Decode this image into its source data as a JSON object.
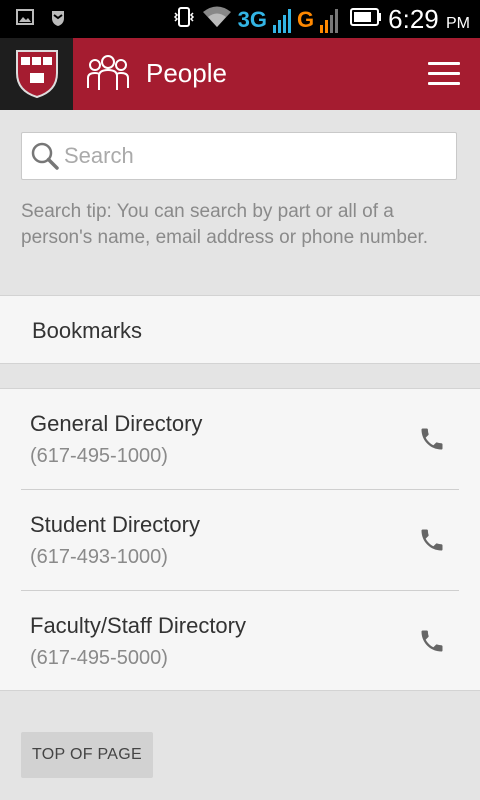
{
  "status_bar": {
    "network_3g": "3G",
    "network_g": "G",
    "time": "6:29",
    "ampm": "PM",
    "icons": [
      "image-icon",
      "shield-icon",
      "vibrate-icon",
      "wifi-icon",
      "signal-icon",
      "battery-icon"
    ]
  },
  "app_bar": {
    "title": "People",
    "logo": "harvard-shield-logo",
    "section_icon": "people-icon",
    "menu_icon": "hamburger-menu-icon",
    "background_color": "#a51c30"
  },
  "search": {
    "placeholder": "Search",
    "value": "",
    "tip": "Search tip: You can search by part or all of a person's name, email address or phone number."
  },
  "bookmarks": {
    "label": "Bookmarks"
  },
  "directories": [
    {
      "name": "General Directory",
      "phone": "(617-495-1000)"
    },
    {
      "name": "Student Directory",
      "phone": "(617-493-1000)"
    },
    {
      "name": "Faculty/Staff Directory",
      "phone": "(617-495-5000)"
    }
  ],
  "top_of_page": {
    "label": "TOP OF PAGE"
  }
}
